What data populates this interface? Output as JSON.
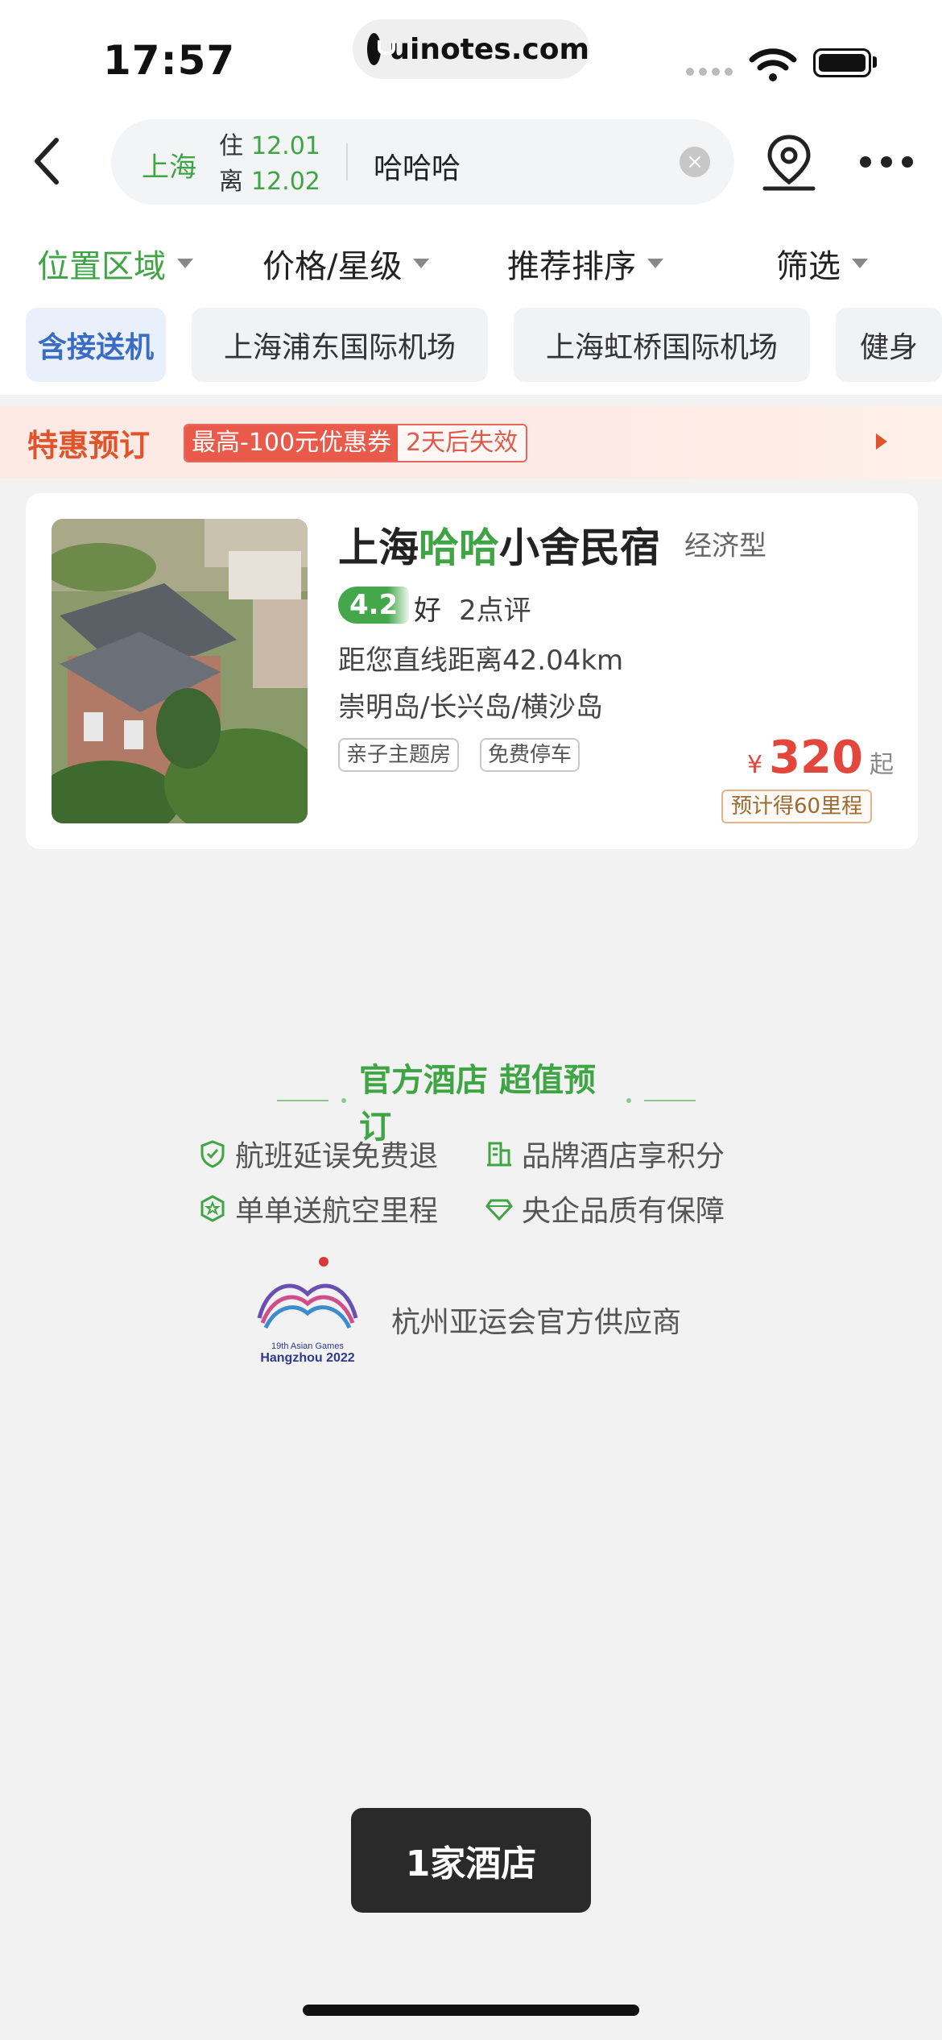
{
  "status_bar": {
    "time": "17:57",
    "url": "uinotes.com"
  },
  "search": {
    "city": "上海",
    "checkin_label": "住",
    "checkin_date": "12.01",
    "checkout_label": "离",
    "checkout_date": "12.02",
    "keyword": "哈哈哈",
    "clear_icon": "×"
  },
  "filters": [
    {
      "label": "位置区域",
      "active": true
    },
    {
      "label": "价格/星级",
      "active": false
    },
    {
      "label": "推荐排序",
      "active": false
    },
    {
      "label": "筛选",
      "active": false
    }
  ],
  "chips": [
    "含接送机",
    "上海浦东国际机场",
    "上海虹桥国际机场",
    "健身"
  ],
  "promo": {
    "title": "特惠预订",
    "coupon": "最高-100元优惠券",
    "expiry": "2天后失效"
  },
  "hotel": {
    "name_prefix": "上海",
    "name_highlight": "哈哈",
    "name_suffix": "小舍民宿",
    "type": "经济型",
    "score": "4.2",
    "score_word": "好",
    "reviews": "2点评",
    "distance": "距您直线距离42.04km",
    "area": "崇明岛/长兴岛/横沙岛",
    "tags": [
      "亲子主题房",
      "免费停车"
    ],
    "currency": "¥",
    "price": "320",
    "price_suffix": "起",
    "mileage": "预计得60里程"
  },
  "official": {
    "title": "官方酒店 超值预订",
    "benefits": [
      "航班延误免费退",
      "品牌酒店享积分",
      "单单送航空里程",
      "央企品质有保障"
    ],
    "logo_text_1": "19th Asian Games",
    "logo_text_2": "Hangzhou 2022",
    "supplier": "杭州亚运会官方供应商"
  },
  "result_count": "1家酒店",
  "colors": {
    "brand_green": "#3fa544",
    "price_red": "#e3463a",
    "promo_orange": "#e0542c"
  }
}
